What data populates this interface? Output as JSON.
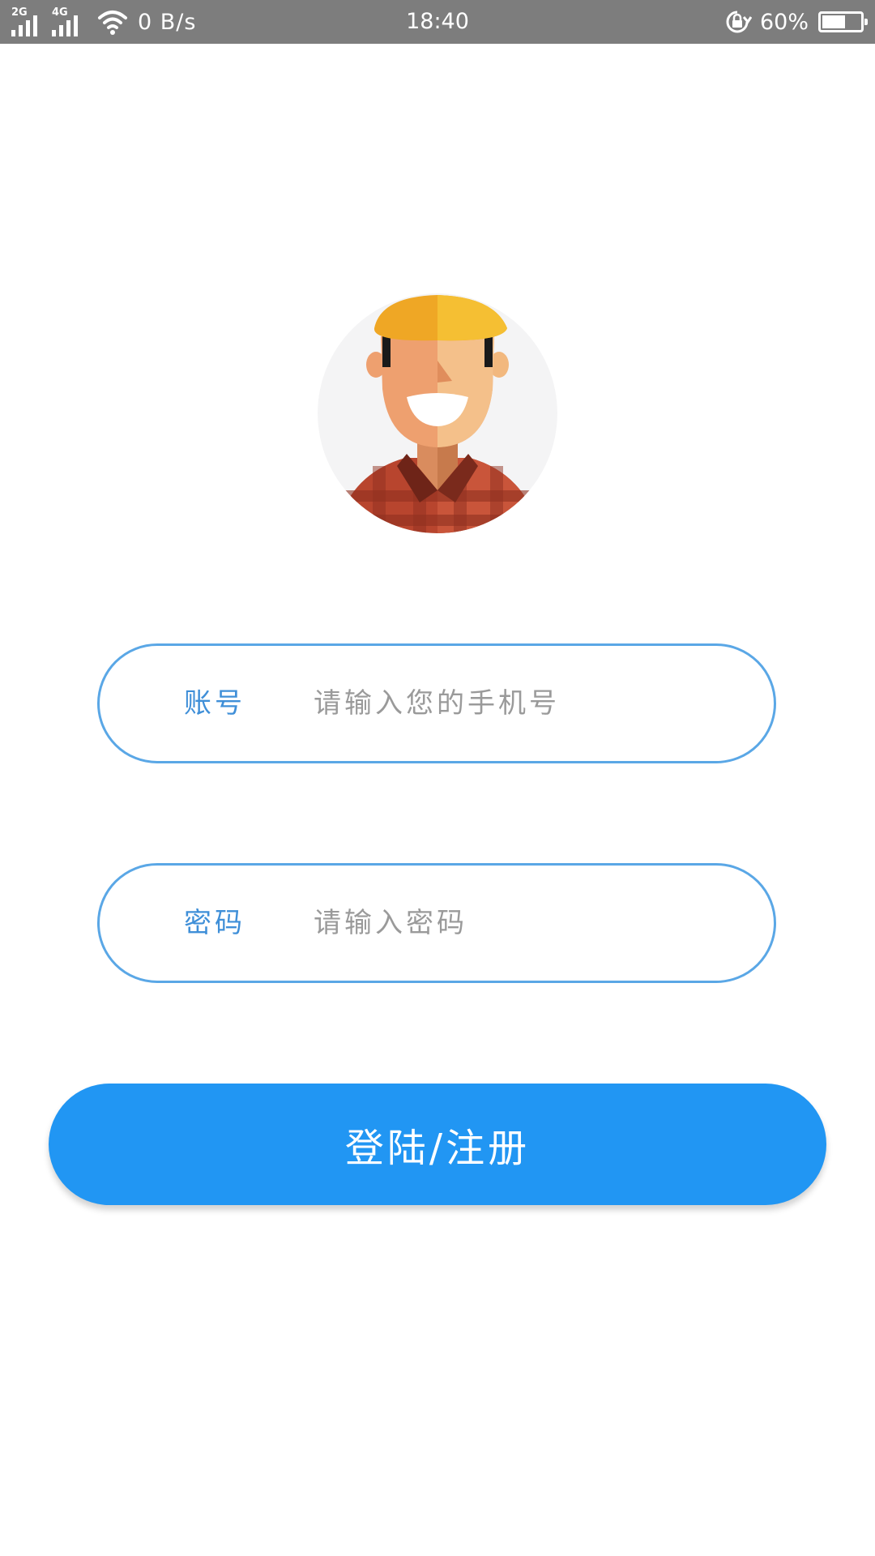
{
  "status_bar": {
    "network_1": "2G",
    "network_2": "4G",
    "speed": "0 B/s",
    "time": "18:40",
    "battery_percent_label": "60%",
    "battery_level": 0.6,
    "icons": [
      "signal-icon",
      "signal-icon",
      "wifi-icon",
      "rotation-lock-icon",
      "battery-icon"
    ]
  },
  "login": {
    "account_label": "账号",
    "account_placeholder": "请输入您的手机号",
    "password_label": "密码",
    "password_placeholder": "请输入密码",
    "submit_label": "登陆/注册"
  },
  "colors": {
    "status_bar_bg": "#7d7d7d",
    "accent": "#2196f3",
    "field_border": "#5aa7e6",
    "label_text": "#3f8fd8",
    "placeholder_text": "#9a9a9a"
  }
}
